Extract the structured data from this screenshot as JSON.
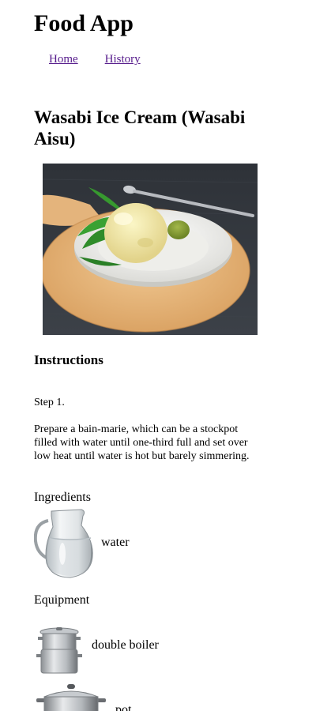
{
  "app": {
    "title": "Food App"
  },
  "nav": {
    "home": "Home",
    "history": "History"
  },
  "recipe": {
    "title": "Wasabi Ice Cream (Wasabi Aisu)"
  },
  "instructions": {
    "heading": "Instructions",
    "step_label": "Step 1.",
    "step_text": "Prepare a bain-marie, which can be a stockpot filled with water until one-third full and set over low heat until water is hot but barely simmering."
  },
  "ingredients": {
    "label": "Ingredients",
    "items": [
      {
        "name": "water",
        "icon": "water-pitcher-image"
      }
    ]
  },
  "equipment": {
    "label": "Equipment",
    "items": [
      {
        "name": "double boiler",
        "icon": "double-boiler-image"
      },
      {
        "name": "pot",
        "icon": "pot-image"
      }
    ]
  },
  "colors": {
    "link": "#551a8b",
    "text": "#000000",
    "background": "#ffffff"
  }
}
